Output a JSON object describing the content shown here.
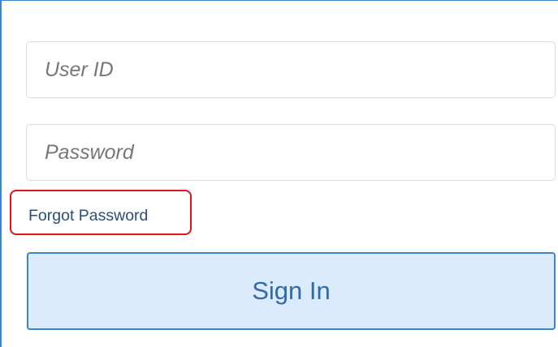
{
  "login_form": {
    "user_id": {
      "value": "",
      "placeholder": "User ID"
    },
    "password": {
      "value": "",
      "placeholder": "Password"
    },
    "forgot_password_label": "Forgot Password",
    "sign_in_label": "Sign In"
  },
  "colors": {
    "frame_border": "#3a86c8",
    "button_background": "#dcebfb",
    "button_text": "#2f6aa8",
    "link_text": "#2a4d7a",
    "highlight": "#e0141e"
  }
}
